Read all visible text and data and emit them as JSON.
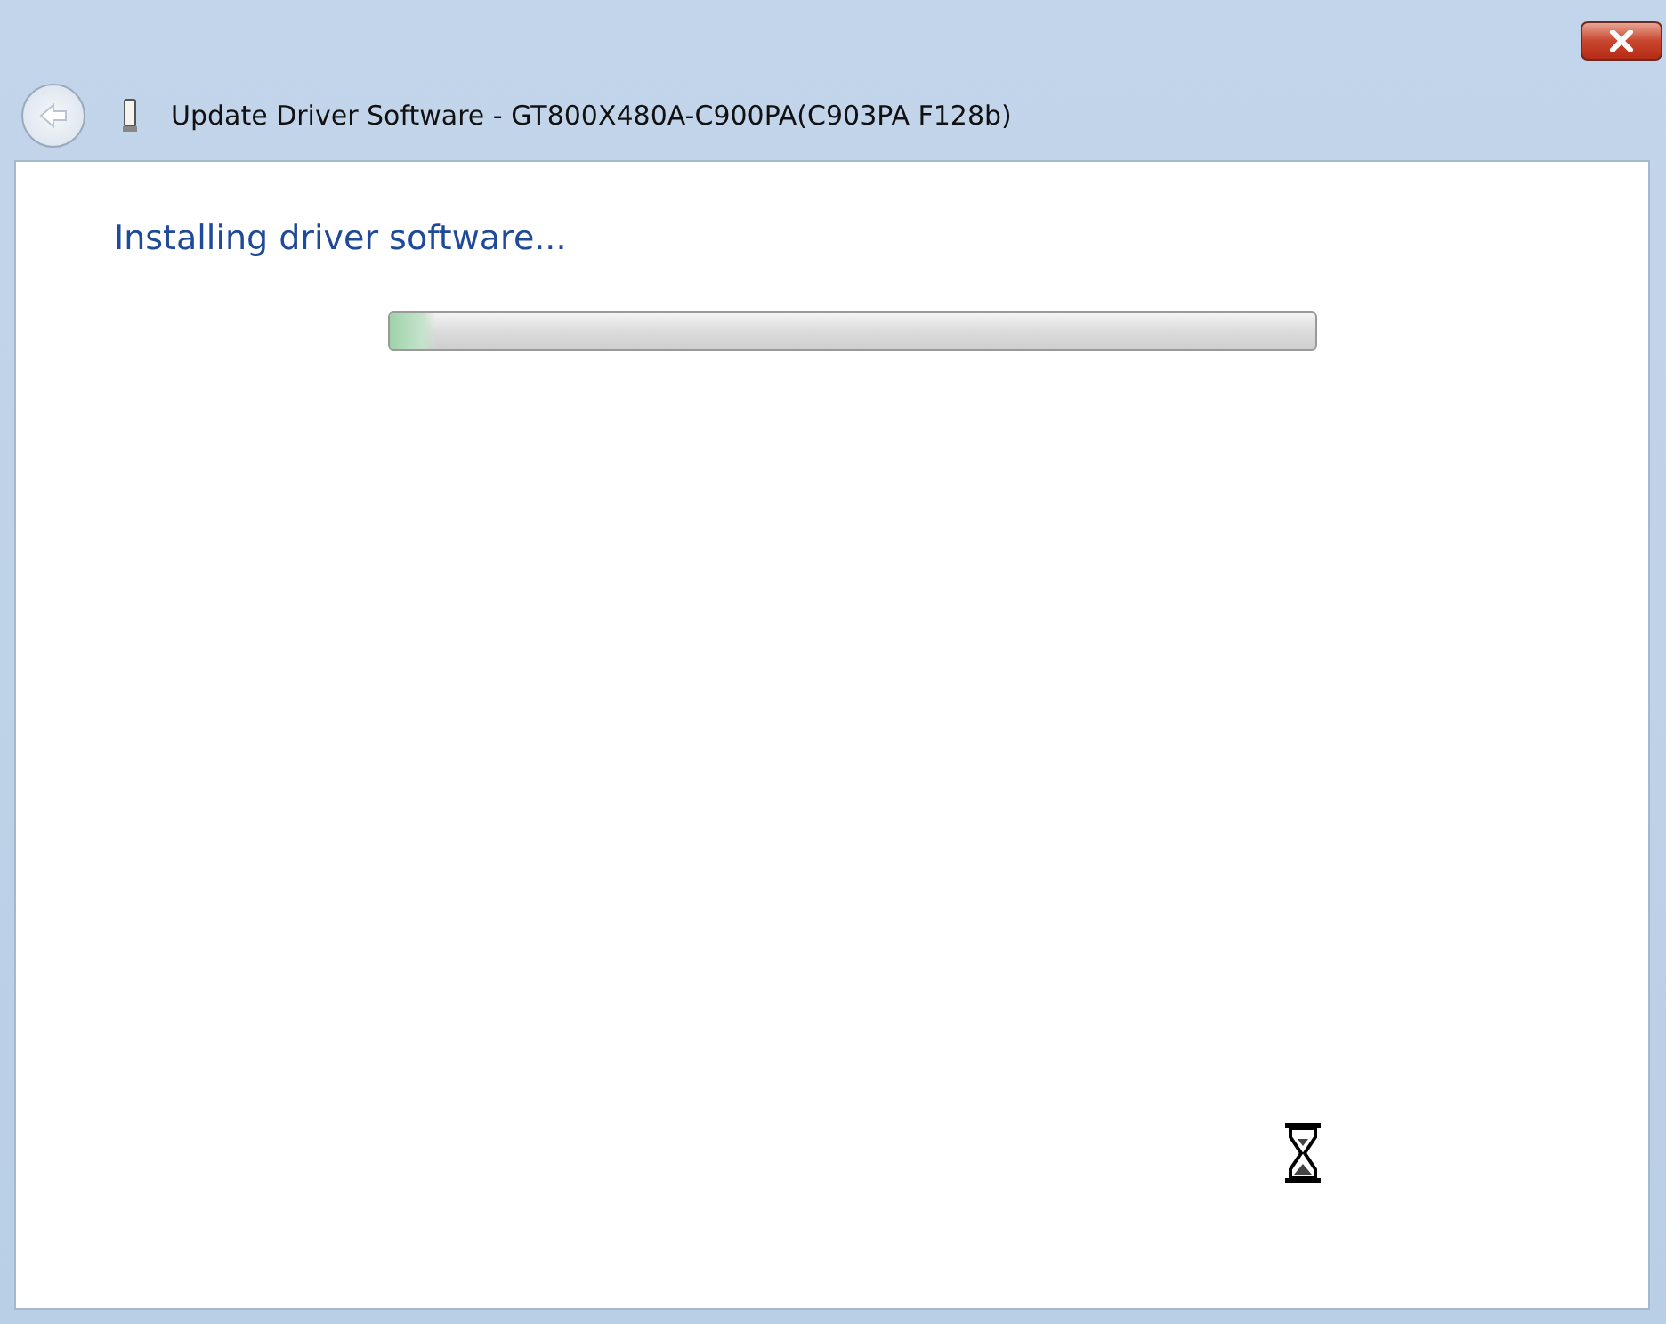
{
  "window": {
    "title": "Update Driver Software - GT800X480A-C900PA(C903PA F128b)"
  },
  "heading": "Installing driver software...",
  "progress": {
    "level": 0.05
  }
}
